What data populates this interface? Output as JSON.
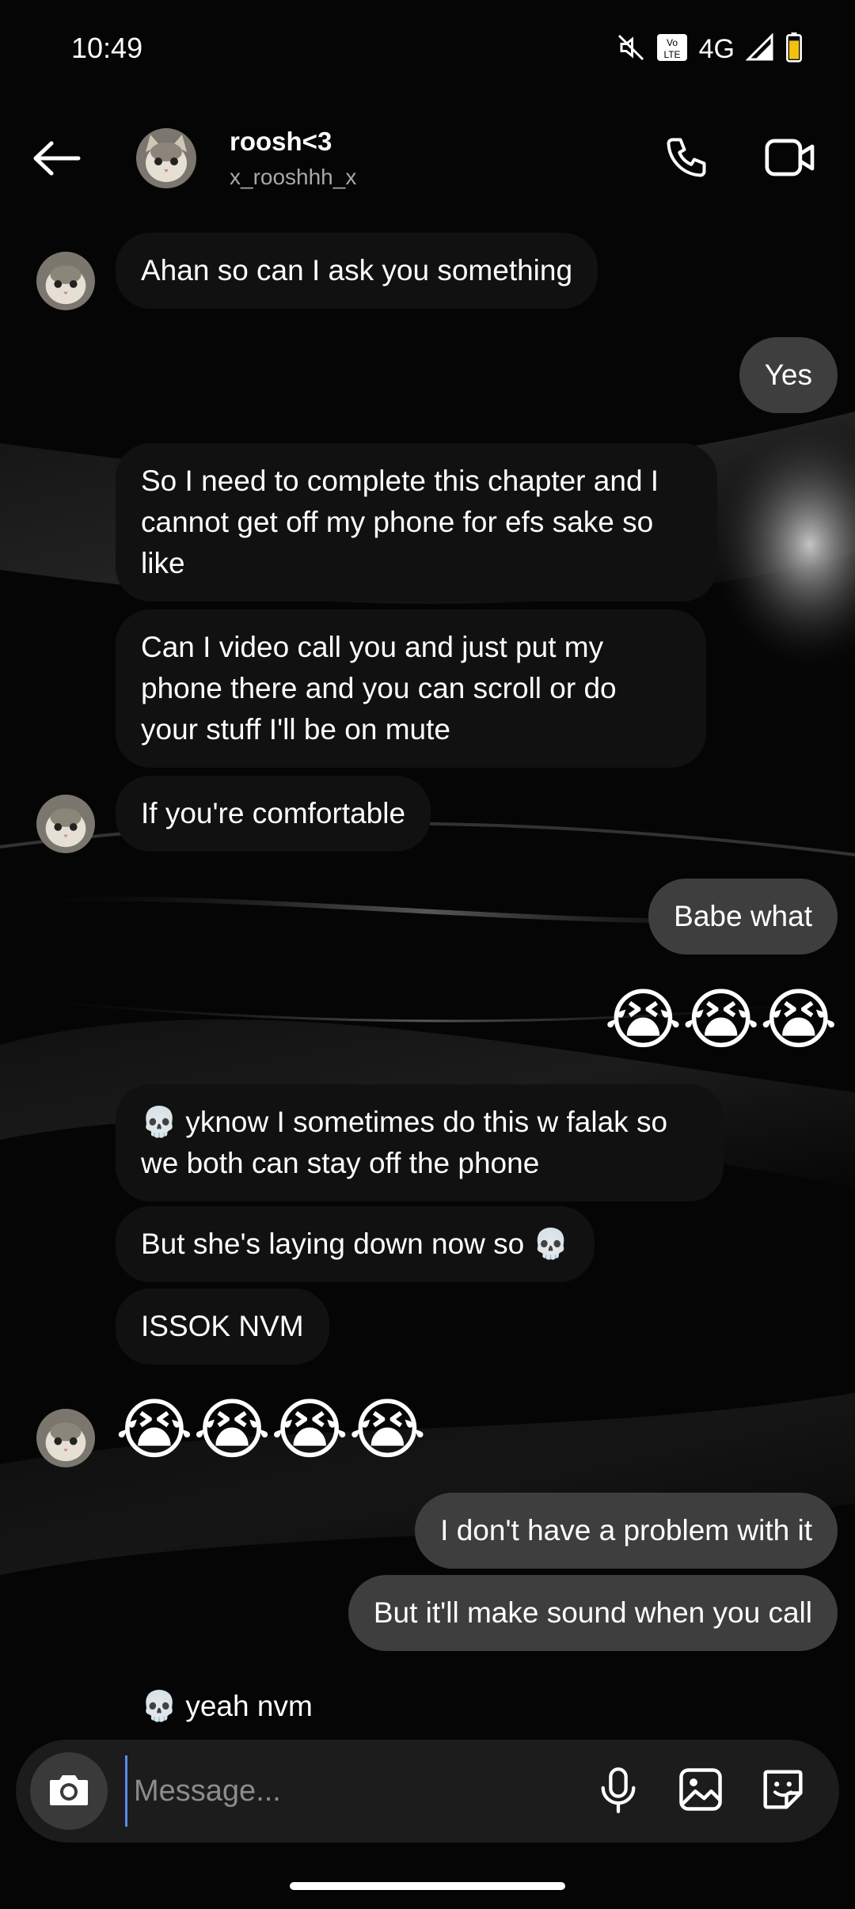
{
  "status_bar": {
    "time": "10:49",
    "network": "4G",
    "volte": "Vo LTE",
    "icons": [
      "mute-icon",
      "volte-icon",
      "signal-icon",
      "battery-icon"
    ]
  },
  "header": {
    "name": "roosh<3",
    "username": "x_rooshhh_x",
    "icons": [
      "back-arrow-icon",
      "phone-icon",
      "video-camera-icon"
    ]
  },
  "messages": [
    {
      "dir": "in",
      "text": "Ahan so can I ask you something"
    },
    {
      "dir": "out",
      "text": "Yes"
    },
    {
      "dir": "in",
      "text": "So I need to complete this chapter and I cannot get off my phone for efs sake so like"
    },
    {
      "dir": "in",
      "text": "Can I video call you and just put my phone there and you can scroll or do your stuff I'll be on mute"
    },
    {
      "dir": "in",
      "text": "If you're comfortable"
    },
    {
      "dir": "out",
      "text": "Babe what"
    },
    {
      "dir": "out",
      "text": "😭😭😭"
    },
    {
      "dir": "in",
      "text": "💀 yknow I sometimes do this w falak so we both can stay off the phone"
    },
    {
      "dir": "in",
      "text": "But she's laying down now so 💀"
    },
    {
      "dir": "in",
      "text": "ISSOK NVM"
    },
    {
      "dir": "in",
      "text": "😭😭😭😭"
    },
    {
      "dir": "out",
      "text": "I don't have a problem with it"
    },
    {
      "dir": "out",
      "text": "But it'll make sound when you call"
    },
    {
      "dir": "in",
      "text": "💀 yeah nvm"
    }
  ],
  "composer": {
    "placeholder": "Message...",
    "icons": [
      "camera-icon",
      "microphone-icon",
      "gallery-icon",
      "sticker-icon"
    ]
  },
  "colors": {
    "background": "#050505",
    "incoming_bubble": "#111111",
    "outgoing_bubble": "#3e3e3e",
    "composer": "#1c1c1c",
    "muted_text": "#a8a8a8"
  }
}
